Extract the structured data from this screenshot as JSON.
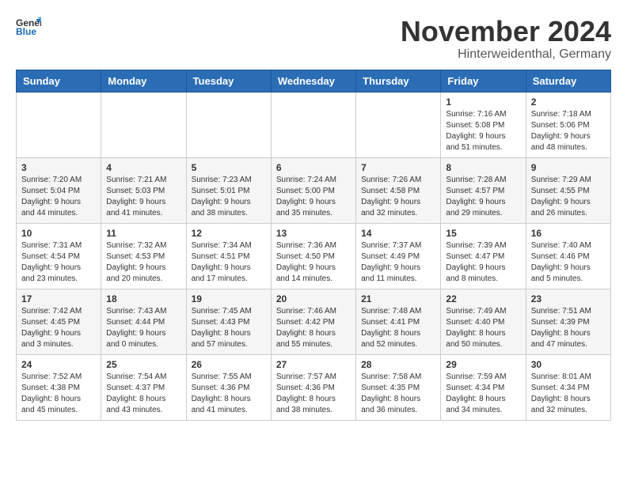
{
  "header": {
    "logo_line1": "General",
    "logo_line2": "Blue",
    "month_title": "November 2024",
    "subtitle": "Hinterweidenthal, Germany"
  },
  "weekdays": [
    "Sunday",
    "Monday",
    "Tuesday",
    "Wednesday",
    "Thursday",
    "Friday",
    "Saturday"
  ],
  "weeks": [
    [
      {
        "day": "",
        "info": ""
      },
      {
        "day": "",
        "info": ""
      },
      {
        "day": "",
        "info": ""
      },
      {
        "day": "",
        "info": ""
      },
      {
        "day": "",
        "info": ""
      },
      {
        "day": "1",
        "info": "Sunrise: 7:16 AM\nSunset: 5:08 PM\nDaylight: 9 hours and 51 minutes."
      },
      {
        "day": "2",
        "info": "Sunrise: 7:18 AM\nSunset: 5:06 PM\nDaylight: 9 hours and 48 minutes."
      }
    ],
    [
      {
        "day": "3",
        "info": "Sunrise: 7:20 AM\nSunset: 5:04 PM\nDaylight: 9 hours and 44 minutes."
      },
      {
        "day": "4",
        "info": "Sunrise: 7:21 AM\nSunset: 5:03 PM\nDaylight: 9 hours and 41 minutes."
      },
      {
        "day": "5",
        "info": "Sunrise: 7:23 AM\nSunset: 5:01 PM\nDaylight: 9 hours and 38 minutes."
      },
      {
        "day": "6",
        "info": "Sunrise: 7:24 AM\nSunset: 5:00 PM\nDaylight: 9 hours and 35 minutes."
      },
      {
        "day": "7",
        "info": "Sunrise: 7:26 AM\nSunset: 4:58 PM\nDaylight: 9 hours and 32 minutes."
      },
      {
        "day": "8",
        "info": "Sunrise: 7:28 AM\nSunset: 4:57 PM\nDaylight: 9 hours and 29 minutes."
      },
      {
        "day": "9",
        "info": "Sunrise: 7:29 AM\nSunset: 4:55 PM\nDaylight: 9 hours and 26 minutes."
      }
    ],
    [
      {
        "day": "10",
        "info": "Sunrise: 7:31 AM\nSunset: 4:54 PM\nDaylight: 9 hours and 23 minutes."
      },
      {
        "day": "11",
        "info": "Sunrise: 7:32 AM\nSunset: 4:53 PM\nDaylight: 9 hours and 20 minutes."
      },
      {
        "day": "12",
        "info": "Sunrise: 7:34 AM\nSunset: 4:51 PM\nDaylight: 9 hours and 17 minutes."
      },
      {
        "day": "13",
        "info": "Sunrise: 7:36 AM\nSunset: 4:50 PM\nDaylight: 9 hours and 14 minutes."
      },
      {
        "day": "14",
        "info": "Sunrise: 7:37 AM\nSunset: 4:49 PM\nDaylight: 9 hours and 11 minutes."
      },
      {
        "day": "15",
        "info": "Sunrise: 7:39 AM\nSunset: 4:47 PM\nDaylight: 9 hours and 8 minutes."
      },
      {
        "day": "16",
        "info": "Sunrise: 7:40 AM\nSunset: 4:46 PM\nDaylight: 9 hours and 5 minutes."
      }
    ],
    [
      {
        "day": "17",
        "info": "Sunrise: 7:42 AM\nSunset: 4:45 PM\nDaylight: 9 hours and 3 minutes."
      },
      {
        "day": "18",
        "info": "Sunrise: 7:43 AM\nSunset: 4:44 PM\nDaylight: 9 hours and 0 minutes."
      },
      {
        "day": "19",
        "info": "Sunrise: 7:45 AM\nSunset: 4:43 PM\nDaylight: 8 hours and 57 minutes."
      },
      {
        "day": "20",
        "info": "Sunrise: 7:46 AM\nSunset: 4:42 PM\nDaylight: 8 hours and 55 minutes."
      },
      {
        "day": "21",
        "info": "Sunrise: 7:48 AM\nSunset: 4:41 PM\nDaylight: 8 hours and 52 minutes."
      },
      {
        "day": "22",
        "info": "Sunrise: 7:49 AM\nSunset: 4:40 PM\nDaylight: 8 hours and 50 minutes."
      },
      {
        "day": "23",
        "info": "Sunrise: 7:51 AM\nSunset: 4:39 PM\nDaylight: 8 hours and 47 minutes."
      }
    ],
    [
      {
        "day": "24",
        "info": "Sunrise: 7:52 AM\nSunset: 4:38 PM\nDaylight: 8 hours and 45 minutes."
      },
      {
        "day": "25",
        "info": "Sunrise: 7:54 AM\nSunset: 4:37 PM\nDaylight: 8 hours and 43 minutes."
      },
      {
        "day": "26",
        "info": "Sunrise: 7:55 AM\nSunset: 4:36 PM\nDaylight: 8 hours and 41 minutes."
      },
      {
        "day": "27",
        "info": "Sunrise: 7:57 AM\nSunset: 4:36 PM\nDaylight: 8 hours and 38 minutes."
      },
      {
        "day": "28",
        "info": "Sunrise: 7:58 AM\nSunset: 4:35 PM\nDaylight: 8 hours and 36 minutes."
      },
      {
        "day": "29",
        "info": "Sunrise: 7:59 AM\nSunset: 4:34 PM\nDaylight: 8 hours and 34 minutes."
      },
      {
        "day": "30",
        "info": "Sunrise: 8:01 AM\nSunset: 4:34 PM\nDaylight: 8 hours and 32 minutes."
      }
    ]
  ]
}
